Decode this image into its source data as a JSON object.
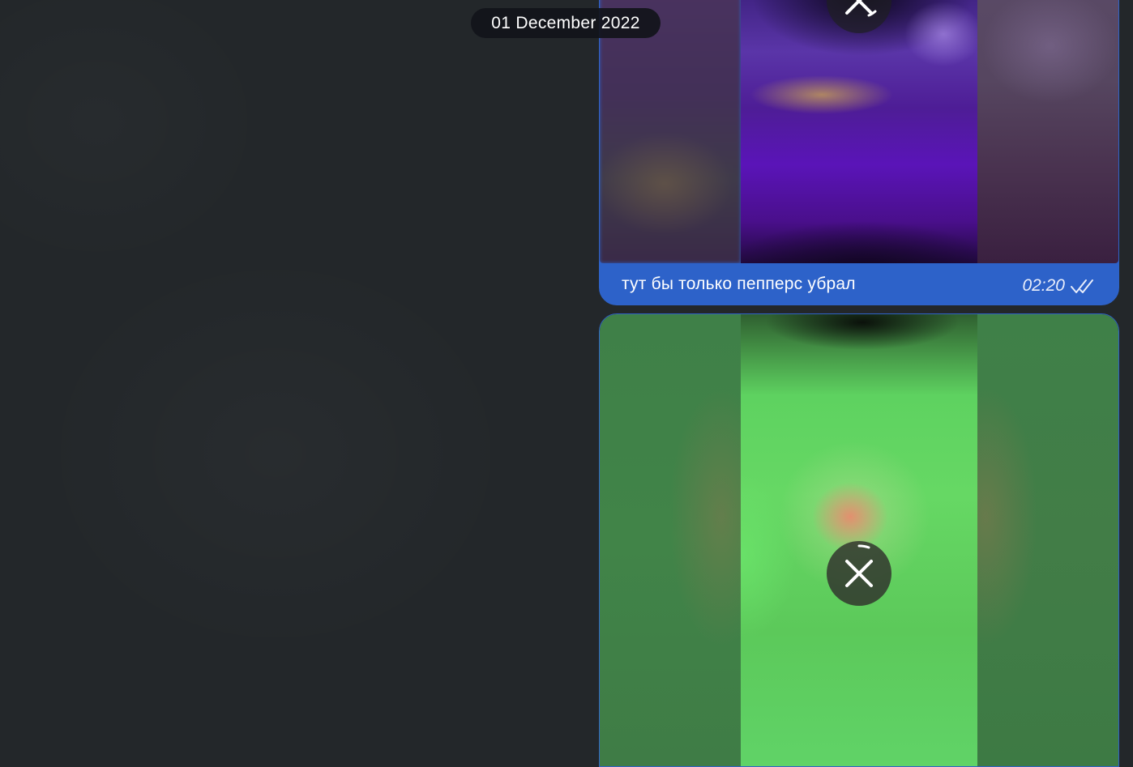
{
  "date_separator": "01 December 2022",
  "messages": [
    {
      "type": "video",
      "caption": "тут бы только пепперс убрал",
      "time": "02:20",
      "status_icon": "double-check-read-icon",
      "action_icon": "close-icon"
    },
    {
      "type": "video",
      "action_icon": "close-icon"
    }
  ],
  "colors": {
    "background": "#23272a",
    "outgoing_bubble": "#2d62c9",
    "date_pill": "#12141a"
  }
}
